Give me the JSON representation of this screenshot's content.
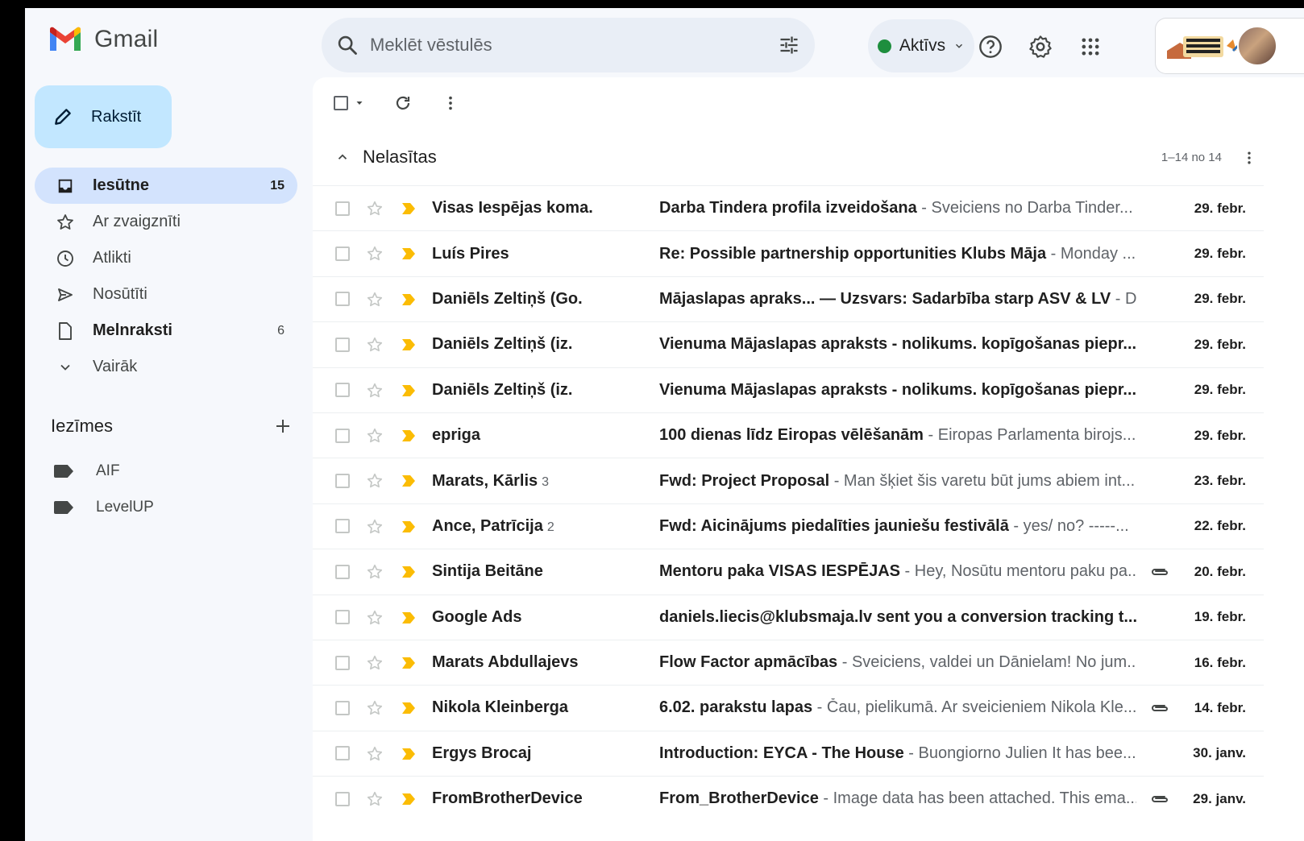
{
  "app": {
    "name": "Gmail"
  },
  "search": {
    "placeholder": "Meklēt vēstulēs"
  },
  "status": {
    "label": "Aktīvs"
  },
  "compose": {
    "label": "Rakstīt"
  },
  "nav": [
    {
      "label": "Iesūtne",
      "count": "15",
      "icon": "inbox-icon"
    },
    {
      "label": "Ar zvaigznīti",
      "count": "",
      "icon": "star-icon"
    },
    {
      "label": "Atlikti",
      "count": "",
      "icon": "clock-icon"
    },
    {
      "label": "Nosūtīti",
      "count": "",
      "icon": "send-icon"
    },
    {
      "label": "Melnraksti",
      "count": "6",
      "icon": "draft-icon"
    },
    {
      "label": "Vairāk",
      "count": "",
      "icon": "chevron-down-icon"
    }
  ],
  "labels": {
    "title": "Iezīmes",
    "items": [
      "AIF",
      "LevelUP"
    ]
  },
  "section": {
    "title": "Nelasītas",
    "range": "1–14 no 14"
  },
  "emails": [
    {
      "sender": "Visas Iespējas koma.",
      "count": "",
      "subject": "Darba Tindera profila izveidošana",
      "snippet": " - Sveiciens no Darba Tinder...",
      "date": "29. febr.",
      "attachment": false
    },
    {
      "sender": "Luís Pires",
      "count": "",
      "subject": "Re: Possible partnership opportunities Klubs Māja",
      "snippet": " - Monday ...",
      "date": "29. febr.",
      "attachment": false
    },
    {
      "sender": "Daniēls Zeltiņš (Go.",
      "count": "",
      "subject": "Mājaslapas apraks... — Uzsvars: Sadarbība starp ASV & LV",
      "snippet": " - D.",
      "date": "29. febr.",
      "attachment": false
    },
    {
      "sender": "Daniēls Zeltiņš (iz.",
      "count": "",
      "subject": "Vienuma Mājaslapas apraksts - nolikums. kopīgošanas piepr...",
      "snippet": "",
      "date": "29. febr.",
      "attachment": false
    },
    {
      "sender": "Daniēls Zeltiņš (iz.",
      "count": "",
      "subject": "Vienuma Mājaslapas apraksts - nolikums. kopīgošanas piepr...",
      "snippet": "",
      "date": "29. febr.",
      "attachment": false
    },
    {
      "sender": "epriga",
      "count": "",
      "subject": "100 dienas līdz Eiropas vēlēšanām",
      "snippet": " - Eiropas Parlamenta birojs...",
      "date": "29. febr.",
      "attachment": false
    },
    {
      "sender": "Marats, Kārlis",
      "count": "3",
      "subject": "Fwd: Project Proposal",
      "snippet": " - Man šķiet šis varetu būt jums abiem int...",
      "date": "23. febr.",
      "attachment": false
    },
    {
      "sender": "Ance, Patrīcija",
      "count": "2",
      "subject": "Fwd: Aicinājums piedalīties jauniešu festivālā",
      "snippet": " - yes/ no? -----...",
      "date": "22. febr.",
      "attachment": false
    },
    {
      "sender": "Sintija Beitāne",
      "count": "",
      "subject": "Mentoru paka VISAS IESPĒJAS",
      "snippet": " - Hey, Nosūtu mentoru paku pa...",
      "date": "20. febr.",
      "attachment": true
    },
    {
      "sender": "Google Ads",
      "count": "",
      "subject": "daniels.liecis@klubsmaja.lv sent you a conversion tracking t...",
      "snippet": "",
      "date": "19. febr.",
      "attachment": false
    },
    {
      "sender": "Marats Abdullajevs",
      "count": "",
      "subject": "Flow Factor apmācības",
      "snippet": " - Sveiciens, valdei un Dānielam! No jum...",
      "date": "16. febr.",
      "attachment": false
    },
    {
      "sender": "Nikola Kleinberga",
      "count": "",
      "subject": "6.02. parakstu lapas",
      "snippet": " - Čau, pielikumā. Ar sveicieniem Nikola Kle...",
      "date": "14. febr.",
      "attachment": true
    },
    {
      "sender": "Ergys Brocaj",
      "count": "",
      "subject": "Introduction: EYCA - The House",
      "snippet": " - Buongiorno Julien It has bee...",
      "date": "30. janv.",
      "attachment": false
    },
    {
      "sender": "FromBrotherDevice",
      "count": "",
      "subject": "From_BrotherDevice",
      "snippet": " - Image data has been attached. This ema...",
      "date": "29. janv.",
      "attachment": true
    }
  ],
  "colors": {
    "accent": "#c2e7ff",
    "active_nav": "#d3e3fd",
    "important_marker": "#fbbc04",
    "status_online": "#1e8e3e"
  }
}
